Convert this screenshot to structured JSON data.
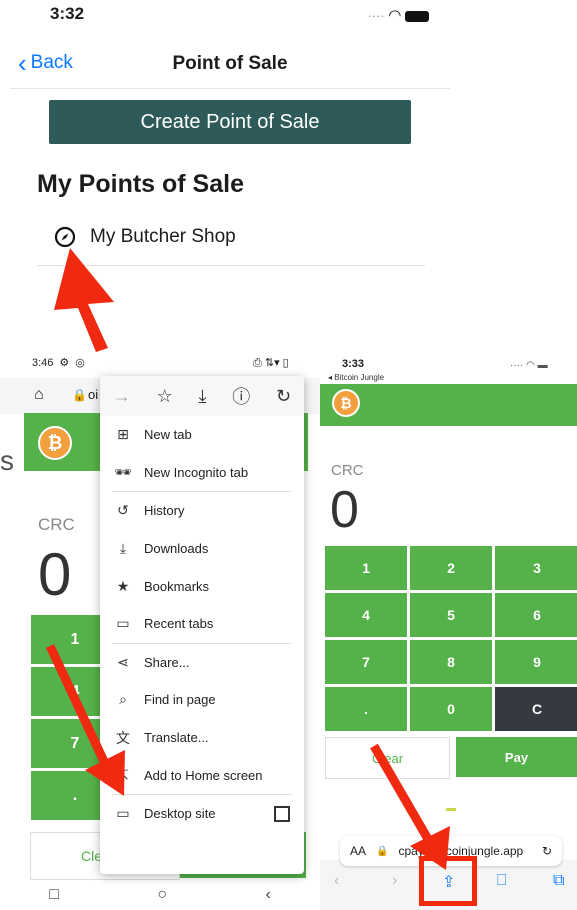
{
  "top": {
    "status_time": "3:32",
    "back_label": "Back",
    "nav_title": "Point of Sale",
    "create_label": "Create Point of Sale",
    "section_title": "My Points of Sale",
    "pos_items": [
      "My Butcher Shop"
    ]
  },
  "android": {
    "status_time": "3:46",
    "crc": "CRC",
    "amount": "0",
    "keys": [
      "1",
      "4",
      "7",
      "."
    ],
    "clear": "Cle",
    "s_letter": "s",
    "menu": {
      "items": [
        {
          "icon": "plus-box-icon",
          "glyph": "⊞",
          "label": "New tab"
        },
        {
          "icon": "incognito-icon",
          "glyph": "🕶",
          "label": "New Incognito tab"
        },
        {
          "icon": "history-icon",
          "glyph": "↺",
          "label": "History"
        },
        {
          "icon": "downloads-icon",
          "glyph": "⤓",
          "label": "Downloads"
        },
        {
          "icon": "bookmark-star-icon",
          "glyph": "★",
          "label": "Bookmarks"
        },
        {
          "icon": "recent-tabs-icon",
          "glyph": "▭",
          "label": "Recent tabs"
        },
        {
          "icon": "share-icon",
          "glyph": "⋖",
          "label": "Share..."
        },
        {
          "icon": "find-icon",
          "glyph": "⌕",
          "label": "Find in page"
        },
        {
          "icon": "translate-icon",
          "glyph": "文",
          "label": "Translate..."
        },
        {
          "icon": "add-home-icon",
          "glyph": "⇱",
          "label": "Add to Home screen"
        },
        {
          "icon": "desktop-icon",
          "glyph": "▭",
          "label": "Desktop site"
        }
      ]
    }
  },
  "ios": {
    "status_time": "3:33",
    "back_app": "◂ Bitcoin Jungle",
    "crc": "CRC",
    "amount": "0",
    "keys": [
      "1",
      "2",
      "3",
      "4",
      "5",
      "6",
      "7",
      "8",
      "9",
      ".",
      "0",
      "C"
    ],
    "clear": "Clear",
    "pay": "Pay",
    "aa": "AA",
    "url": "cpays.bitcoinjungle.app"
  },
  "colors": {
    "accent_green": "#55b14a",
    "dark_teal": "#2f5a5a",
    "arrow_red": "#f02a10",
    "ios_blue": "#0a7aff"
  }
}
